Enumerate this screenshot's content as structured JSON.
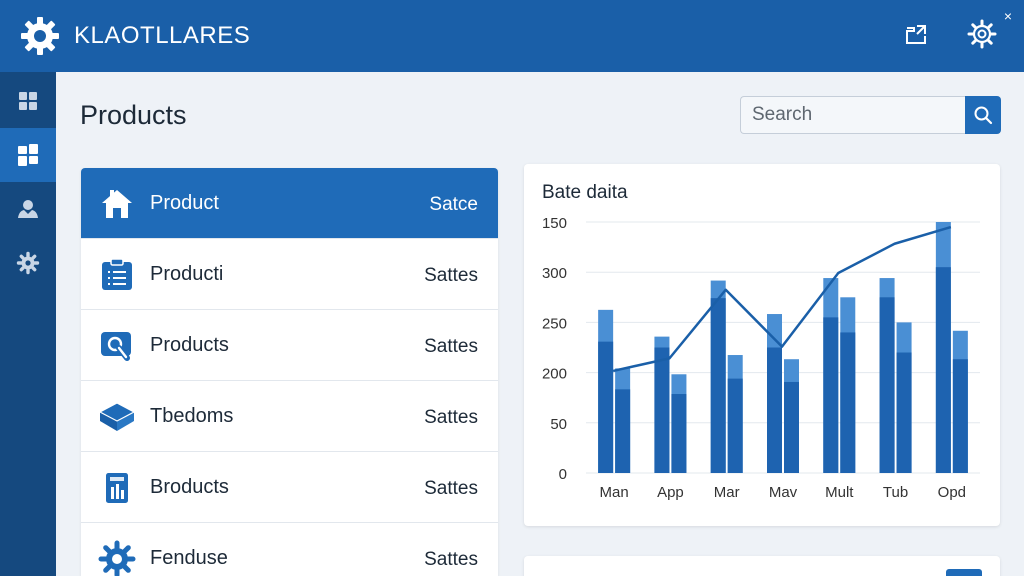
{
  "app": {
    "title": "KLAOTLLARES"
  },
  "topbar": {
    "export_icon": "export-icon",
    "settings_icon": "gear-icon",
    "close_label": "×"
  },
  "sidebar": {
    "items": [
      {
        "icon": "grid-icon"
      },
      {
        "icon": "dashboard-icon",
        "active": true
      },
      {
        "icon": "users-icon"
      },
      {
        "icon": "gear-icon"
      }
    ]
  },
  "page": {
    "title": "Products"
  },
  "search": {
    "placeholder": "Search"
  },
  "list": {
    "items": [
      {
        "name": "Product",
        "status": "Satce",
        "icon": "home-icon",
        "selected": true
      },
      {
        "name": "Producti",
        "status": "Sattes",
        "icon": "clipboard-icon"
      },
      {
        "name": "Products",
        "status": "Sattes",
        "icon": "search-chat-icon"
      },
      {
        "name": "Tbedoms",
        "status": "Sattes",
        "icon": "box-icon"
      },
      {
        "name": "Broducts",
        "status": "Sattes",
        "icon": "document-icon"
      },
      {
        "name": "Fenduse",
        "status": "Sattes",
        "icon": "gear-icon"
      }
    ]
  },
  "colors": {
    "brand": "#1a5fa8",
    "sidebar": "#15497f",
    "accent": "#1f6bb8",
    "bar_light": "#4a8fd4",
    "bar_dark": "#1e63b0"
  },
  "chart_data": {
    "type": "bar",
    "title": "Bate daita",
    "categories": [
      "Man",
      "App",
      "Mar",
      "Mav",
      "Mult",
      "Tub",
      "Opd"
    ],
    "y_tick_labels": [
      "150",
      "300",
      "250",
      "200",
      "50",
      "0"
    ],
    "ylim": [
      0,
      300
    ],
    "grid": true,
    "series": [
      {
        "values": [
          195,
          163,
          230,
          190,
          233,
          233,
          300
        ]
      },
      {
        "values": [
          157,
          150,
          209,
          150,
          186,
          210,
          246
        ]
      },
      {
        "values": [
          125,
          118,
          141,
          136,
          210,
          180,
          170
        ]
      }
    ],
    "overlay_line": {
      "type": "line",
      "values": [
        122,
        137,
        219,
        151,
        239,
        274,
        294
      ]
    }
  }
}
